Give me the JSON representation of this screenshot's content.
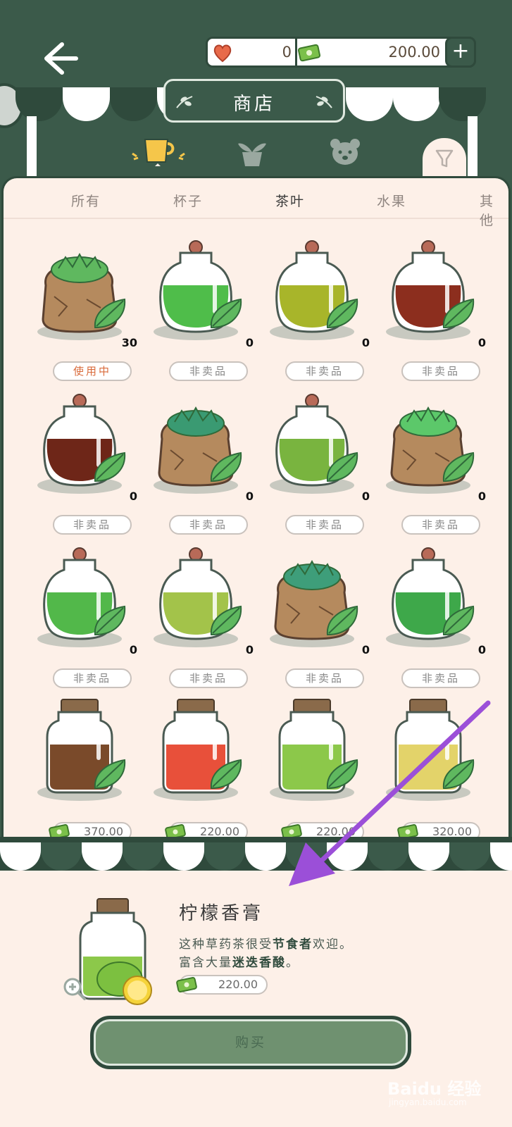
{
  "header": {
    "hearts": "0",
    "money": "200.00",
    "plus_label": "+",
    "shop_title": "商店"
  },
  "tabs": [
    "所有",
    "杯子",
    "茶叶",
    "水果",
    "其他"
  ],
  "items": [
    {
      "type": "bag",
      "color": "#5fb85f",
      "count": "30",
      "status": "使用中",
      "active": true
    },
    {
      "type": "jar",
      "color": "#4fbd4a",
      "count": "0",
      "status": "非卖品"
    },
    {
      "type": "jar",
      "color": "#a8b52a",
      "count": "0",
      "status": "非卖品"
    },
    {
      "type": "jar",
      "color": "#8c2e1e",
      "count": "0",
      "status": "非卖品"
    },
    {
      "type": "jar",
      "color": "#6e2618",
      "count": "0",
      "status": "非卖品"
    },
    {
      "type": "bag",
      "color": "#3a9a72",
      "count": "0",
      "status": "非卖品"
    },
    {
      "type": "jar",
      "color": "#79b43f",
      "count": "0",
      "status": "非卖品"
    },
    {
      "type": "bag",
      "color": "#5cc86a",
      "count": "0",
      "status": "非卖品"
    },
    {
      "type": "jar",
      "color": "#52b84a",
      "count": "0",
      "status": "非卖品"
    },
    {
      "type": "jar",
      "color": "#a3c34a",
      "count": "0",
      "status": "非卖品"
    },
    {
      "type": "bag",
      "color": "#3e9e7a",
      "count": "0",
      "status": "非卖品"
    },
    {
      "type": "jar",
      "color": "#3ea84a",
      "count": "0",
      "status": "非卖品"
    },
    {
      "type": "bottle",
      "color": "#7a4a2a",
      "price": "370.00"
    },
    {
      "type": "bottle",
      "color": "#e8503a",
      "price": "220.00"
    },
    {
      "type": "bottle",
      "color": "#8cc84a",
      "price": "220.00"
    },
    {
      "type": "bottle",
      "color": "#e3d36a",
      "price": "320.00"
    }
  ],
  "detail": {
    "name": "柠檬香膏",
    "desc1_a": "这种草药茶很受",
    "desc1_b": "节食者",
    "desc1_c": "欢迎。",
    "desc2_a": "富含大量",
    "desc2_b": "迷迭香酸",
    "desc2_c": "。",
    "price": "220.00",
    "buy_label": "购买"
  },
  "watermark": {
    "main": "Baidu 经验",
    "sub": "jingyan.baidu.com"
  },
  "colors": {
    "dark_green": "#2f4a3c",
    "panel_bg": "#fdf0e8",
    "buy_green": "#6f9170",
    "arrow": "#9b4fd8"
  }
}
